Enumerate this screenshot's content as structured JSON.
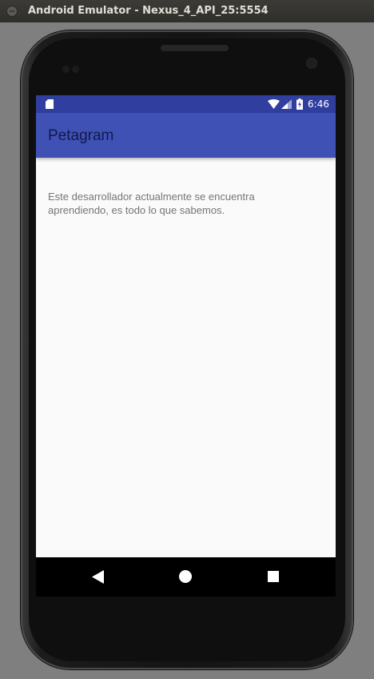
{
  "window": {
    "title": "Android Emulator - Nexus_4_API_25:5554"
  },
  "statusbar": {
    "time": "6:46",
    "icons": [
      "sd-card-icon",
      "wifi-icon",
      "cellular-signal-icon",
      "battery-charging-icon"
    ]
  },
  "appbar": {
    "title": "Petagram"
  },
  "content": {
    "message": "Este desarrollador actualmente se encuentra aprendiendo, es todo lo que sabemos."
  },
  "navbar": {
    "buttons": [
      "back-button",
      "home-button",
      "recents-button"
    ]
  },
  "colors": {
    "primary": "#3f51b5",
    "primary_dark": "#303f9f",
    "background": "#fafafa",
    "text_secondary": "#757575"
  }
}
